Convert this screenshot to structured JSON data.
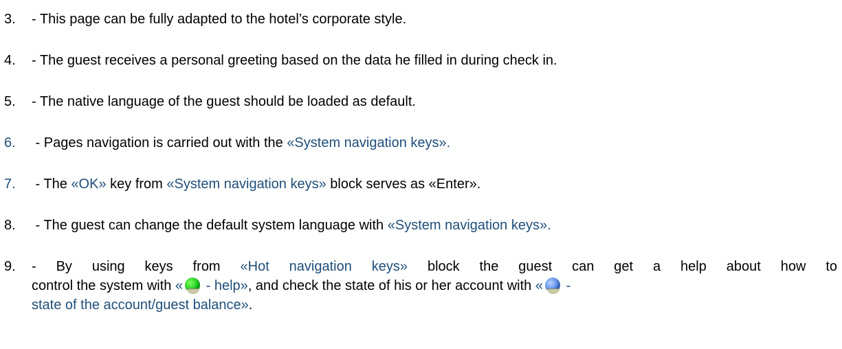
{
  "items": [
    {
      "num": "3.",
      "text": "- This page can be fully adapted to the hotel’s corporate style."
    },
    {
      "num": "4.",
      "text": "- The guest receives a personal greeting based on the data he filled in during check in."
    },
    {
      "num": "5.",
      "text": "- The native language of the guest should be loaded as default."
    },
    {
      "num": "6.",
      "pre": " -  Pages navigation is carried out with the ",
      "link": "«System navigation keys»."
    },
    {
      "num": "7.",
      "pre": " -  The ",
      "link1": "«OK»",
      "mid": " key from ",
      "link2": "«System navigation keys»",
      "post": " block serves as «Enter»."
    },
    {
      "num": "8.",
      "pre": " -  The guest can change the default system language with ",
      "link": "«System navigation keys»."
    },
    {
      "num": "9.",
      "pre": "- By using keys from ",
      "link1": "«Hot navigation keys»",
      "mid1": " block the guest can get a help about how to",
      "line2_pre": "control the system with ",
      "q1": "«",
      "green_label": " - help»",
      "line2_mid": ", and check the state of his or her account with ",
      "q2": "«",
      "blue_label_a": " -",
      "blue_label_b": "state of the account/guest balance»",
      "line3_post": "."
    }
  ],
  "icons": {
    "green": "green-ball-icon",
    "blue": "blue-ball-icon"
  },
  "colors": {
    "accent": "#1f4e79",
    "green": "#11c41b",
    "blue": "#4a7fe0"
  }
}
